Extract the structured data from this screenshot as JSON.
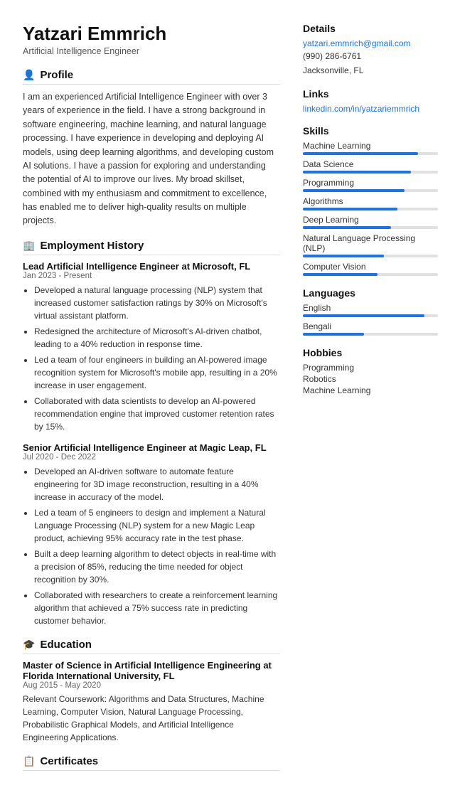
{
  "header": {
    "name": "Yatzari Emmrich",
    "subtitle": "Artificial Intelligence Engineer"
  },
  "profile": {
    "section_title": "Profile",
    "icon": "👤",
    "text": "I am an experienced Artificial Intelligence Engineer with over 3 years of experience in the field. I have a strong background in software engineering, machine learning, and natural language processing. I have experience in developing and deploying AI models, using deep learning algorithms, and developing custom AI solutions. I have a passion for exploring and understanding the potential of AI to improve our lives. My broad skillset, combined with my enthusiasm and commitment to excellence, has enabled me to deliver high-quality results on multiple projects."
  },
  "employment": {
    "section_title": "Employment History",
    "icon": "🏢",
    "jobs": [
      {
        "title": "Lead Artificial Intelligence Engineer at Microsoft, FL",
        "date": "Jan 2023 - Present",
        "bullets": [
          "Developed a natural language processing (NLP) system that increased customer satisfaction ratings by 30% on Microsoft's virtual assistant platform.",
          "Redesigned the architecture of Microsoft's AI-driven chatbot, leading to a 40% reduction in response time.",
          "Led a team of four engineers in building an AI-powered image recognition system for Microsoft's mobile app, resulting in a 20% increase in user engagement.",
          "Collaborated with data scientists to develop an AI-powered recommendation engine that improved customer retention rates by 15%."
        ]
      },
      {
        "title": "Senior Artificial Intelligence Engineer at Magic Leap, FL",
        "date": "Jul 2020 - Dec 2022",
        "bullets": [
          "Developed an AI-driven software to automate feature engineering for 3D image reconstruction, resulting in a 40% increase in accuracy of the model.",
          "Led a team of 5 engineers to design and implement a Natural Language Processing (NLP) system for a new Magic Leap product, achieving 95% accuracy rate in the test phase.",
          "Built a deep learning algorithm to detect objects in real-time with a precision of 85%, reducing the time needed for object recognition by 30%.",
          "Collaborated with researchers to create a reinforcement learning algorithm that achieved a 75% success rate in predicting customer behavior."
        ]
      }
    ]
  },
  "education": {
    "section_title": "Education",
    "icon": "🎓",
    "items": [
      {
        "degree": "Master of Science in Artificial Intelligence Engineering at Florida International University, FL",
        "date": "Aug 2015 - May 2020",
        "desc": "Relevant Coursework: Algorithms and Data Structures, Machine Learning, Computer Vision, Natural Language Processing, Probabilistic Graphical Models, and Artificial Intelligence Engineering Applications."
      }
    ]
  },
  "certificates": {
    "section_title": "Certificates",
    "icon": "📋"
  },
  "details": {
    "section_title": "Details",
    "email": "yatzari.emmrich@gmail.com",
    "phone": "(990) 286-6761",
    "location": "Jacksonville, FL"
  },
  "links": {
    "section_title": "Links",
    "items": [
      {
        "label": "linkedin.com/in/yatzariemmrich",
        "url": "#"
      }
    ]
  },
  "skills": {
    "section_title": "Skills",
    "items": [
      {
        "label": "Machine Learning",
        "pct": 85
      },
      {
        "label": "Data Science",
        "pct": 80
      },
      {
        "label": "Programming",
        "pct": 75
      },
      {
        "label": "Algorithms",
        "pct": 70
      },
      {
        "label": "Deep Learning",
        "pct": 65
      },
      {
        "label": "Natural Language Processing (NLP)",
        "pct": 60
      },
      {
        "label": "Computer Vision",
        "pct": 55
      }
    ]
  },
  "languages": {
    "section_title": "Languages",
    "items": [
      {
        "label": "English",
        "pct": 90
      },
      {
        "label": "Bengali",
        "pct": 45
      }
    ]
  },
  "hobbies": {
    "section_title": "Hobbies",
    "items": [
      "Programming",
      "Robotics",
      "Machine Learning"
    ]
  }
}
